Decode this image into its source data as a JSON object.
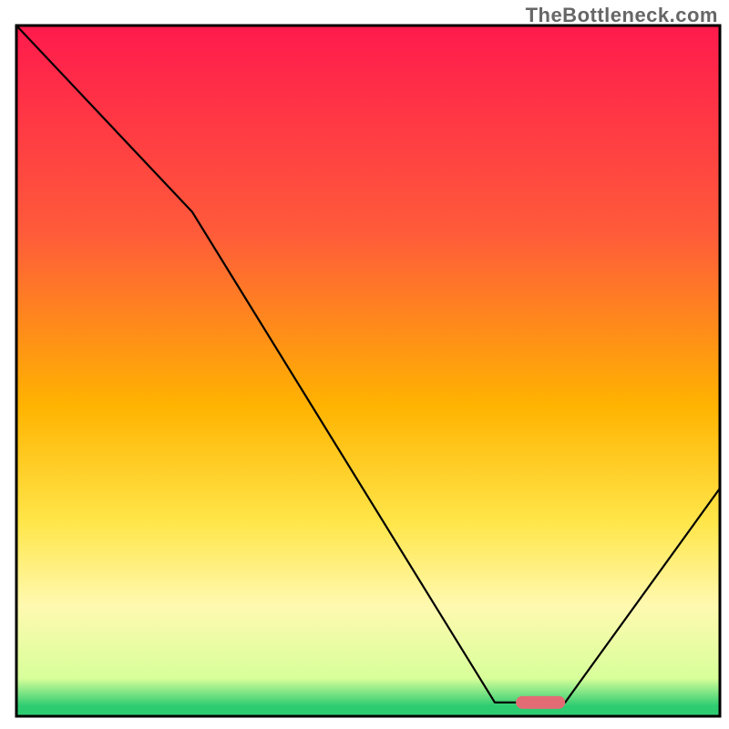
{
  "watermark": "TheBottleneck.com",
  "chart_data": {
    "type": "line",
    "title": "",
    "xlabel": "",
    "ylabel": "",
    "xlim": [
      0,
      100
    ],
    "ylim": [
      0,
      100
    ],
    "x": [
      0,
      25,
      68,
      72,
      78,
      100
    ],
    "values": [
      100,
      73,
      2,
      2,
      2,
      33
    ],
    "optimum_marker": {
      "x_start": 71,
      "x_end": 78,
      "y": 2,
      "color": "#e36c74"
    },
    "background_gradient": {
      "stops": [
        {
          "offset": 0,
          "color": "#ff1a4d"
        },
        {
          "offset": 0.3,
          "color": "#ff5b3a"
        },
        {
          "offset": 0.55,
          "color": "#ffb300"
        },
        {
          "offset": 0.72,
          "color": "#ffe64a"
        },
        {
          "offset": 0.84,
          "color": "#fff9b0"
        },
        {
          "offset": 0.945,
          "color": "#d8ff9a"
        },
        {
          "offset": 0.985,
          "color": "#2ecc71"
        },
        {
          "offset": 1.0,
          "color": "#2ecc71"
        }
      ]
    },
    "frame_color": "#000000",
    "curve_color": "#000000",
    "curve_width": 2.2
  }
}
